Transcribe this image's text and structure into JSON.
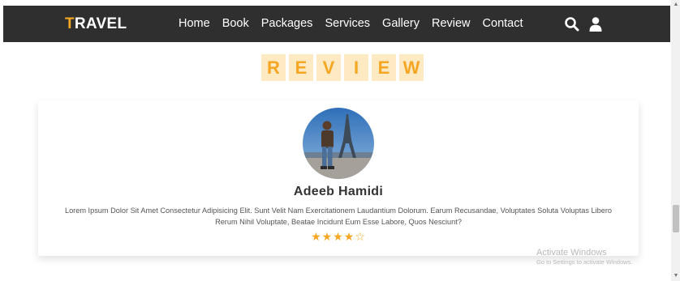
{
  "navbar": {
    "logo_accent": "T",
    "logo_rest": "RAVEL",
    "links": [
      "Home",
      "Book",
      "Packages",
      "Services",
      "Gallery",
      "Review",
      "Contact"
    ],
    "icons": [
      "search-icon",
      "user-icon"
    ]
  },
  "section": {
    "heading_letters": [
      "R",
      "E",
      "V",
      "I",
      "E",
      "W"
    ]
  },
  "review": {
    "name": "Adeeb Hamidi",
    "text": "Lorem Ipsum Dolor Sit Amet Consectetur Adipisicing Elit. Sunt Velit Nam Exercitationem Laudantium Dolorum. Earum Recusandae, Voluptates Soluta Voluptas Libero Rerum Nihil Voluptate, Beatae Incidunt Eum Esse Labore, Quos Nesciunt?",
    "rating": 4,
    "rating_max": 5
  },
  "watermark": {
    "title": "Activate Windows",
    "subtitle": "Go to Settings to activate Windows."
  },
  "colors": {
    "accent": "#f5a623",
    "navbar_bg": "#2f2f2f",
    "heading_bg": "#fde9c2"
  }
}
